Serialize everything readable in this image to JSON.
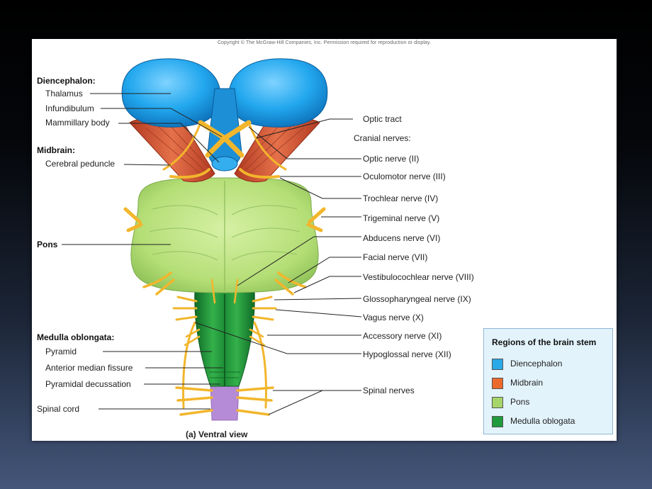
{
  "copyright": "Copyright © The McGraw-Hill Companies, Inc. Permission required for reproduction or display.",
  "left_labels": {
    "diencephalon_heading": "Diencephalon:",
    "thalamus": "Thalamus",
    "infundibulum": "Infundibulum",
    "mammillary_body": "Mammillary body",
    "midbrain_heading": "Midbrain:",
    "cerebral_peduncle": "Cerebral peduncle",
    "pons": "Pons",
    "medulla_heading": "Medulla oblongata:",
    "pyramid": "Pyramid",
    "anterior_median_fissure": "Anterior median fissure",
    "pyramidal_decussation": "Pyramidal decussation",
    "spinal_cord": "Spinal cord"
  },
  "right_labels": {
    "optic_tract": "Optic tract",
    "cranial_nerves_heading": "Cranial nerves:",
    "optic_nerve": "Optic nerve (II)",
    "oculomotor_nerve": "Oculomotor nerve (III)",
    "trochlear_nerve": "Trochlear nerve (IV)",
    "trigeminal_nerve": "Trigeminal nerve (V)",
    "abducens_nerve": "Abducens nerve (VI)",
    "facial_nerve": "Facial nerve (VII)",
    "vestibulocochlear_nerve": "Vestibulocochlear nerve (VIII)",
    "glossopharyngeal_nerve": "Glossopharyngeal nerve (IX)",
    "vagus_nerve": "Vagus nerve (X)",
    "accessory_nerve": "Accessory nerve (XI)",
    "hypoglossal_nerve": "Hypoglossal nerve (XII)",
    "spinal_nerves": "Spinal nerves"
  },
  "caption": "(a) Ventral view",
  "legend": {
    "title": "Regions of the brain stem",
    "items": [
      {
        "label": "Diencephalon",
        "color": "#29a9e8"
      },
      {
        "label": "Midbrain",
        "color": "#ec6a2c"
      },
      {
        "label": "Pons",
        "color": "#a6d66a"
      },
      {
        "label": "Medulla oblogata",
        "color": "#1f9a3c"
      }
    ]
  },
  "colors": {
    "diencephalon": "#29a9e8",
    "midbrain": "#d9573a",
    "pons": "#b9e07e",
    "medulla": "#1f9a3c",
    "nerve": "#f2b62c",
    "spinal_cord": "#b58ad6"
  }
}
